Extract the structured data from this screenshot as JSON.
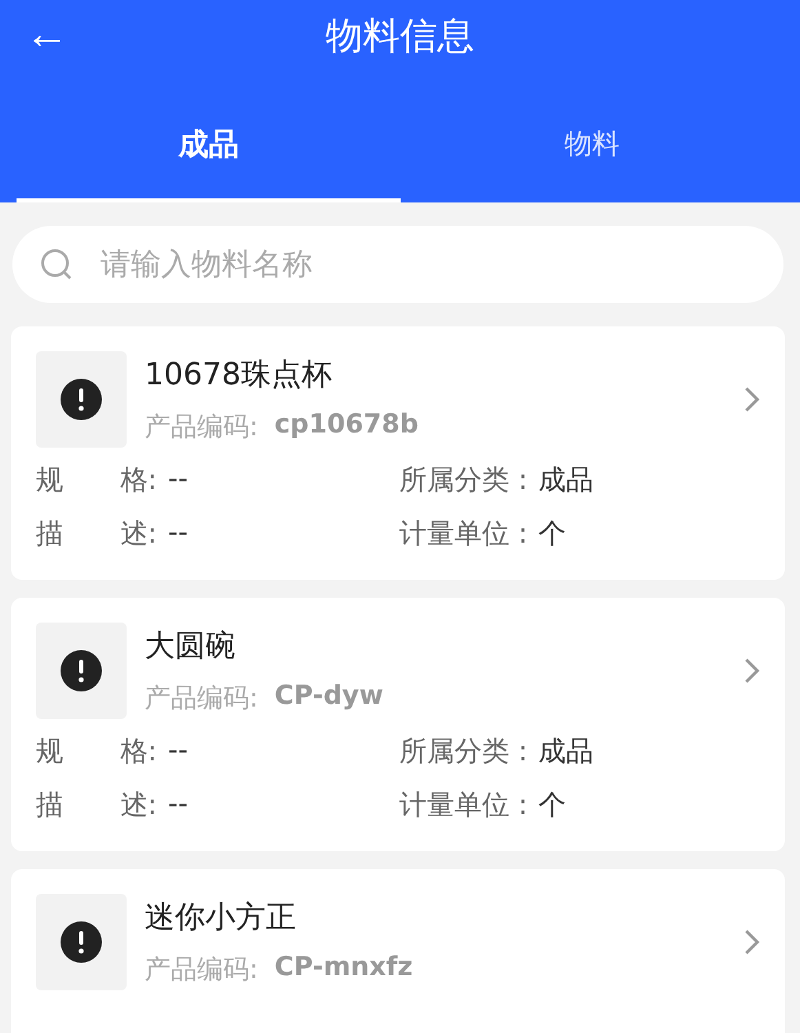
{
  "header": {
    "back": "←",
    "title": "物料信息"
  },
  "tabs": [
    {
      "label": "成品",
      "selected": true
    },
    {
      "label": "物料",
      "selected": false
    }
  ],
  "search": {
    "placeholder": "请输入物料名称"
  },
  "items": [
    {
      "name": "10678珠点杯",
      "code_label": "产品编码:",
      "code": "cp10678b",
      "fields": [
        {
          "label_parts": [
            "规",
            "格:"
          ],
          "value": "--"
        },
        {
          "label": "所属分类 :",
          "value": "成品"
        },
        {
          "label_parts": [
            "描",
            "述:"
          ],
          "value": "--"
        },
        {
          "label": "计量单位 :",
          "value": "个"
        }
      ]
    },
    {
      "name": "大圆碗",
      "code_label": "产品编码:",
      "code": "CP-dyw",
      "fields": [
        {
          "label_parts": [
            "规",
            "格:"
          ],
          "value": "--"
        },
        {
          "label": "所属分类 :",
          "value": "成品"
        },
        {
          "label_parts": [
            "描",
            "述:"
          ],
          "value": "--"
        },
        {
          "label": "计量单位 :",
          "value": "个"
        }
      ]
    },
    {
      "name": "迷你小方正",
      "code_label": "产品编码:",
      "code": "CP-mnxfz"
    }
  ]
}
